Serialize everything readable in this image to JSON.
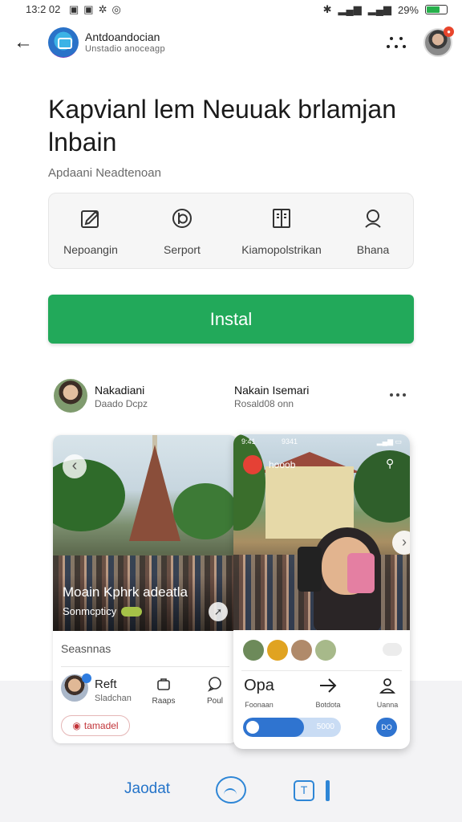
{
  "status_bar": {
    "time": "13:2 02",
    "battery_text": "29%"
  },
  "app": {
    "name": "Antdoandocian",
    "subtitle": "Unstadio anoceagp"
  },
  "headline": "Kapvianl lem Neuuak brlamjan lnbain",
  "subhead": "Apdaani Neadtenoan",
  "features": [
    {
      "icon": "edit-icon",
      "label": "Nepoangin"
    },
    {
      "icon": "support-icon",
      "label": "Serport"
    },
    {
      "icon": "guide-book-icon",
      "label": "Kiamopolstrikan"
    },
    {
      "icon": "search-person-icon",
      "label": "Bhana"
    }
  ],
  "install_label": "Instal",
  "reviewer": {
    "name": "Nakadiani",
    "sub": "Daado Dcpz",
    "name2": "Nakain Isemari",
    "sub2": "Rosald08 onn"
  },
  "left_card": {
    "photo_title": "Moain Kphrk adeatla",
    "photo_sub": "Sonmcpticy",
    "section_label": "Seasnnas",
    "profile_name": "Reft",
    "profile_sub": "Sladchan",
    "action1": "Raaps",
    "action2": "Poul",
    "tag": "tamadel"
  },
  "right_card": {
    "status_time": "9:41",
    "status_center": "9341",
    "live_label": "hooob",
    "action1_big": "Opa",
    "action1_label": "Foonaan",
    "action2_label": "Botdota",
    "action3_label": "Uanna",
    "progress_value": "5000",
    "progress_fraction": 0.62,
    "round_btn": "DO"
  },
  "bottom_nav": {
    "label": "Jaodat"
  },
  "colors": {
    "accent_green": "#22a95a",
    "accent_blue": "#2e86d6",
    "alert_red": "#e8452c"
  }
}
